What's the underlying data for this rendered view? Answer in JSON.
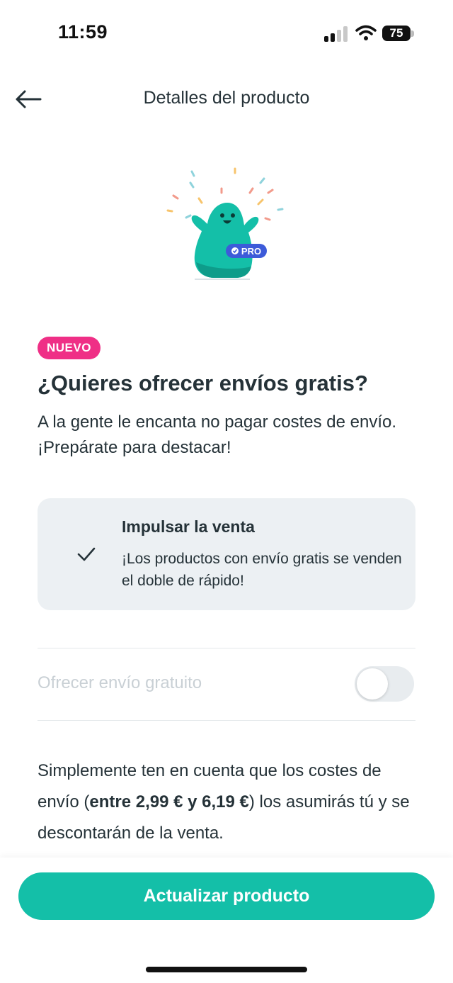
{
  "status_bar": {
    "time": "11:59",
    "battery": "75"
  },
  "header": {
    "title": "Detalles del producto"
  },
  "illustration": {
    "badge": "PRO"
  },
  "content": {
    "badge": "NUEVO",
    "heading": "¿Quieres ofrecer envíos gratis?",
    "subtext": "A la gente le encanta no pagar costes de envío. ¡Prepárate para destacar!"
  },
  "card": {
    "title": "Impulsar la venta",
    "description": "¡Los productos con envío gratis se venden el doble de rápido!"
  },
  "toggle": {
    "label": "Ofrecer envío gratuito",
    "enabled": false
  },
  "note": {
    "prefix": "Simplemente ten en cuenta que los costes de envío (",
    "bold": "entre 2,99 € y 6,19 €",
    "suffix": ") los asumirás tú y se descontarán de la venta."
  },
  "footer": {
    "button": "Actualizar producto"
  },
  "colors": {
    "accent": "#14bfa8",
    "badge": "#ef2f86",
    "pro": "#3d5bd9"
  }
}
